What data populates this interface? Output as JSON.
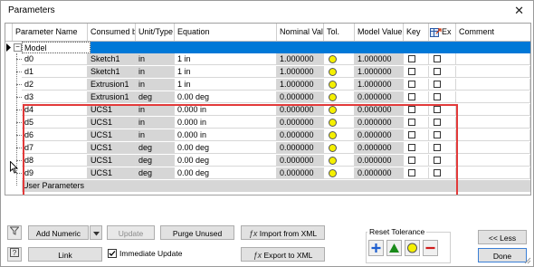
{
  "window": {
    "title": "Parameters",
    "close_glyph": "✕"
  },
  "columns": [
    "Parameter Name",
    "Consumed b",
    "Unit/Type",
    "Equation",
    "Nominal Valu",
    "Tol.",
    "Model Value",
    "Key",
    "Ex",
    "Comment"
  ],
  "groups": {
    "model": "Model Parameters",
    "user": "User Parameters",
    "expander": "−"
  },
  "rows": [
    {
      "name": "d0",
      "consumed": "Sketch1",
      "unit": "in",
      "equation": "1 in",
      "nominal": "1.000000",
      "model": "1.000000"
    },
    {
      "name": "d1",
      "consumed": "Sketch1",
      "unit": "in",
      "equation": "1 in",
      "nominal": "1.000000",
      "model": "1.000000"
    },
    {
      "name": "d2",
      "consumed": "Extrusion1",
      "unit": "in",
      "equation": "1 in",
      "nominal": "1.000000",
      "model": "1.000000"
    },
    {
      "name": "d3",
      "consumed": "Extrusion1",
      "unit": "deg",
      "equation": "0.00 deg",
      "nominal": "0.000000",
      "model": "0.000000"
    },
    {
      "name": "d4",
      "consumed": "UCS1",
      "unit": "in",
      "equation": "0.000 in",
      "nominal": "0.000000",
      "model": "0.000000"
    },
    {
      "name": "d5",
      "consumed": "UCS1",
      "unit": "in",
      "equation": "0.000 in",
      "nominal": "0.000000",
      "model": "0.000000"
    },
    {
      "name": "d6",
      "consumed": "UCS1",
      "unit": "in",
      "equation": "0.000 in",
      "nominal": "0.000000",
      "model": "0.000000"
    },
    {
      "name": "d7",
      "consumed": "UCS1",
      "unit": "deg",
      "equation": "0.00 deg",
      "nominal": "0.000000",
      "model": "0.000000"
    },
    {
      "name": "d8",
      "consumed": "UCS1",
      "unit": "deg",
      "equation": "0.00 deg",
      "nominal": "0.000000",
      "model": "0.000000"
    },
    {
      "name": "d9",
      "consumed": "UCS1",
      "unit": "deg",
      "equation": "0.00 deg",
      "nominal": "0.000000",
      "model": "0.000000"
    }
  ],
  "buttons": {
    "add_numeric": "Add Numeric",
    "update": "Update",
    "purge_unused": "Purge Unused",
    "import_xml": "Import from XML",
    "link": "Link",
    "immediate_update": "Immediate Update",
    "export_xml": "Export to XML",
    "less": "<< Less",
    "done": "Done",
    "reset_tolerance": "Reset Tolerance"
  },
  "colors": {
    "selection": "#0078d7",
    "tolerance_yellow": "#f5f000",
    "tol_plus": "#1f5fcf",
    "tol_up": "#1a8a1a",
    "tol_minus": "#d01c1c",
    "highlight": "#e23a3a"
  },
  "icons": [
    "filter-icon",
    "help-icon",
    "fx-import-icon",
    "fx-export-icon",
    "export-column-icon",
    "dropdown-arrow-icon",
    "row-pointer-icon"
  ]
}
